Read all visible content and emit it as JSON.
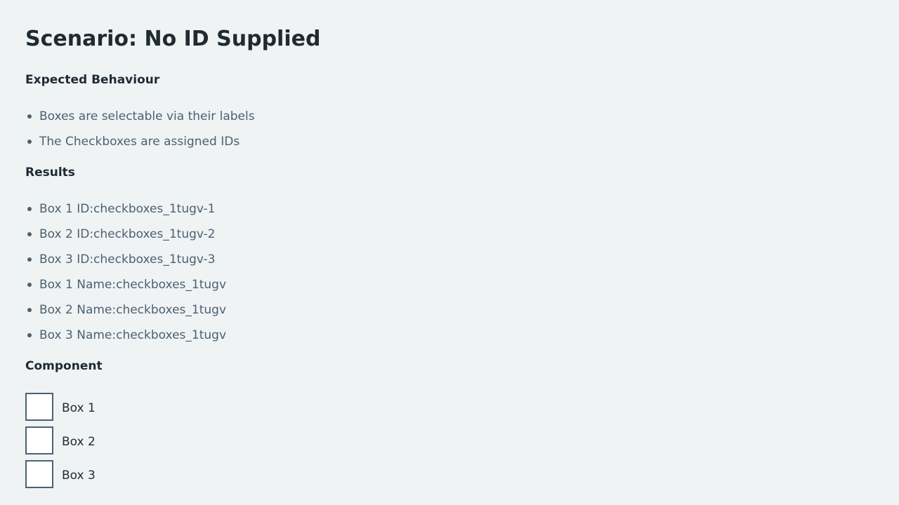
{
  "title": "Scenario: No ID Supplied",
  "expected": {
    "heading": "Expected Behaviour",
    "items": [
      "Boxes are selectable via their labels",
      "The Checkboxes are assigned IDs"
    ]
  },
  "results": {
    "heading": "Results",
    "items": [
      "Box 1 ID:checkboxes_1tugv-1",
      "Box 2 ID:checkboxes_1tugv-2",
      "Box 3 ID:checkboxes_1tugv-3",
      "Box 1 Name:checkboxes_1tugv",
      "Box 2 Name:checkboxes_1tugv",
      "Box 3 Name:checkboxes_1tugv"
    ]
  },
  "component": {
    "heading": "Component",
    "checkboxes": [
      {
        "label": "Box 1",
        "checked": false
      },
      {
        "label": "Box 2",
        "checked": false
      },
      {
        "label": "Box 3",
        "checked": false
      }
    ]
  },
  "colors": {
    "background": "#eff3f4",
    "heading_text": "#1f2a33",
    "body_text": "#4c6170",
    "checkbox_border": "#4c6170"
  }
}
